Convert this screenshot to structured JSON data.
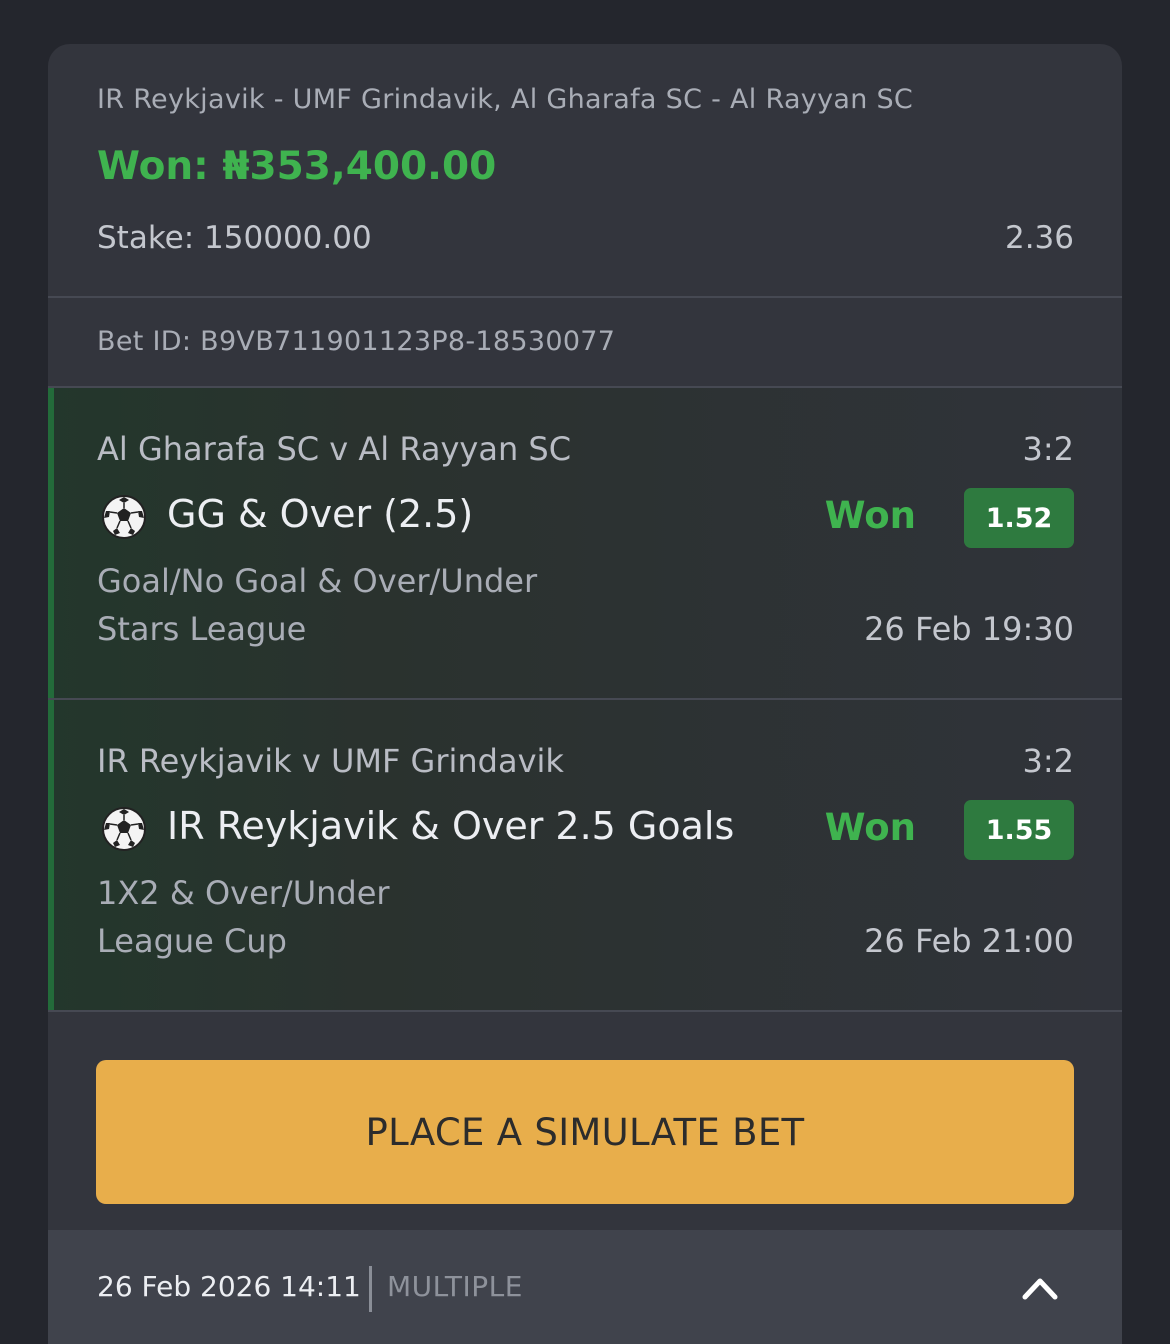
{
  "bet": {
    "matches_title": "IR Reykjavik - UMF Grindavik, Al Gharafa SC - Al Rayyan SC",
    "won_label": "Won: ₦353,400.00",
    "stake_label": "Stake: 150000.00",
    "total_odds": "2.36",
    "bet_id_label": "Bet ID: B9VB711901123P8-18530077"
  },
  "selections": [
    {
      "event": "Al Gharafa SC v Al Rayyan SC",
      "score": "3:2",
      "pick": "GG & Over (2.5)",
      "status": "Won",
      "odds": "1.52",
      "market": "Goal/No Goal & Over/Under",
      "league": "Stars League",
      "kickoff": "26 Feb 19:30",
      "icon": "soccer-ball-icon"
    },
    {
      "event": "IR Reykjavik v UMF Grindavik",
      "score": "3:2",
      "pick": "IR Reykjavik & Over 2.5 Goals",
      "status": "Won",
      "odds": "1.55",
      "market": "1X2 & Over/Under",
      "league": "League Cup",
      "kickoff": "26 Feb 21:00",
      "icon": "soccer-ball-icon"
    }
  ],
  "action": {
    "simulate_label": "PLACE A SIMULATE BET"
  },
  "footer": {
    "placed_at": "26 Feb 2026 14:11",
    "bet_type": "MULTIPLE",
    "toggle_icon": "chevron-up-icon"
  },
  "colors": {
    "won": "#3fb34f",
    "odds_badge": "#2e7a3f",
    "button": "#e8ae4b",
    "card": "#33353d",
    "page": "#24262d"
  }
}
